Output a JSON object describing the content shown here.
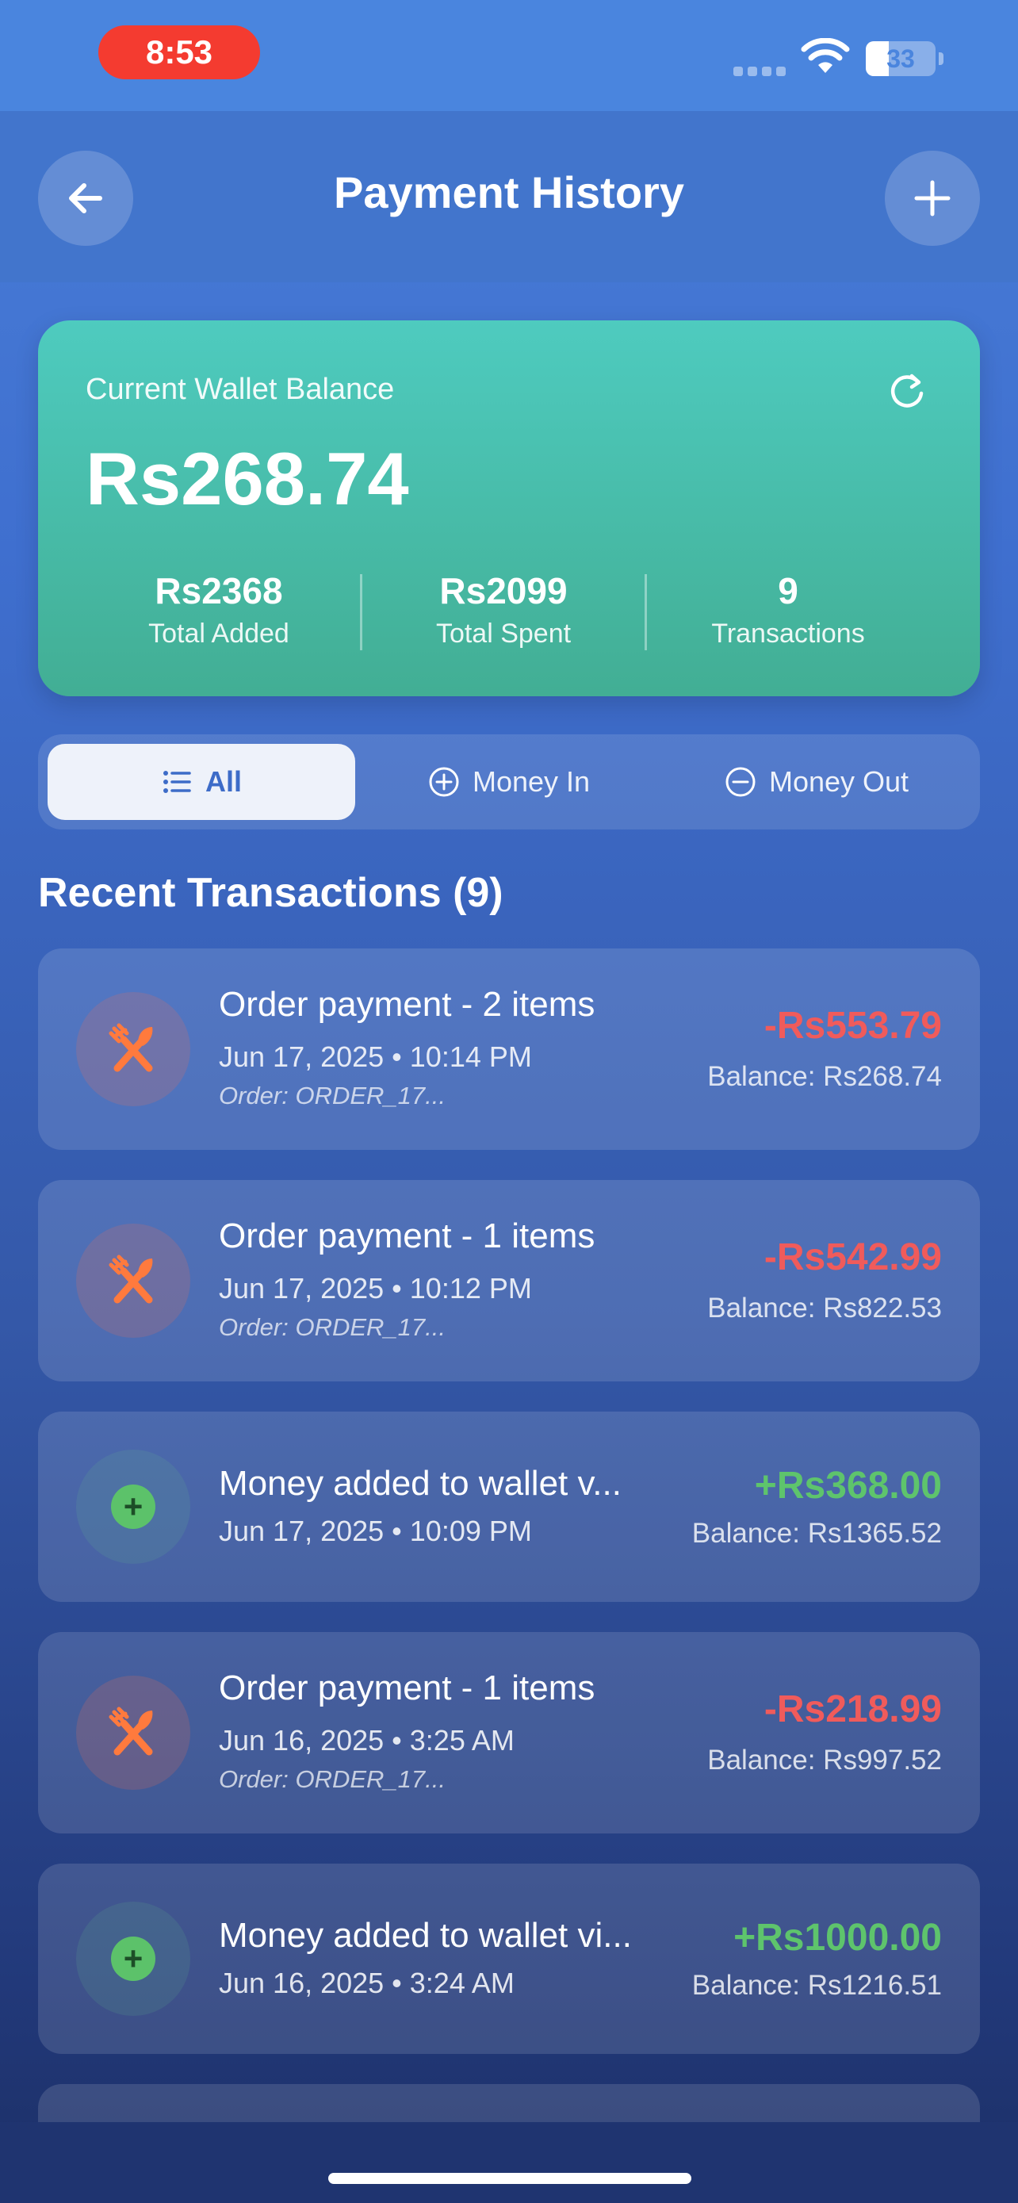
{
  "status_bar": {
    "time": "8:53",
    "battery": "33",
    "battery_level": 0.33
  },
  "header": {
    "title": "Payment History"
  },
  "wallet": {
    "label": "Current Wallet Balance",
    "balance": "Rs268.74",
    "stats": [
      {
        "value": "Rs2368",
        "label": "Total Added"
      },
      {
        "value": "Rs2099",
        "label": "Total Spent"
      },
      {
        "value": "9",
        "label": "Transactions"
      }
    ]
  },
  "tabs": [
    {
      "label": "All",
      "icon": "list-icon",
      "active": true
    },
    {
      "label": "Money In",
      "icon": "plus-circle-icon",
      "active": false
    },
    {
      "label": "Money Out",
      "icon": "minus-circle-icon",
      "active": false
    }
  ],
  "section": {
    "title": "Recent Transactions (9)"
  },
  "transactions": [
    {
      "type": "order",
      "icon": "utensils-icon",
      "title": "Order payment - 2 items",
      "date": "Jun 17, 2025 • 10:14 PM",
      "order": "Order: ORDER_17...",
      "amount": "-Rs553.79",
      "balance": "Balance: Rs268.74"
    },
    {
      "type": "order",
      "icon": "utensils-icon",
      "title": "Order payment - 1 items",
      "date": "Jun 17, 2025 • 10:12 PM",
      "order": "Order: ORDER_17...",
      "amount": "-Rs542.99",
      "balance": "Balance: Rs822.53"
    },
    {
      "type": "topup",
      "icon": "plus-icon",
      "title": "Money added to wallet v...",
      "date": "Jun 17, 2025 • 10:09 PM",
      "amount": "+Rs368.00",
      "balance": "Balance: Rs1365.52"
    },
    {
      "type": "order",
      "icon": "utensils-icon",
      "title": "Order payment - 1 items",
      "date": "Jun 16, 2025 • 3:25 AM",
      "order": "Order: ORDER_17...",
      "amount": "-Rs218.99",
      "balance": "Balance: Rs997.52"
    },
    {
      "type": "topup",
      "icon": "plus-icon",
      "title": "Money added to wallet vi...",
      "date": "Jun 16, 2025 • 3:24 AM",
      "amount": "+Rs1000.00",
      "balance": "Balance: Rs1216.51"
    }
  ],
  "colors": {
    "negative": "#f05b5b",
    "positive": "#5ec46c",
    "card_top": "#4ecbbf",
    "card_bottom": "#42ae94"
  }
}
